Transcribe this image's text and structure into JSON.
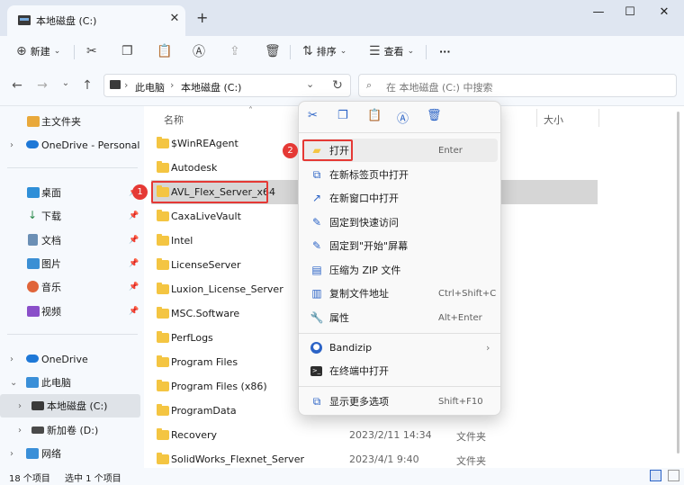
{
  "window": {
    "tab_title": "本地磁盘 (C:)",
    "tab_close": "✕",
    "tab_add": "+",
    "minimize": "—",
    "maximize": "☐",
    "close": "✕"
  },
  "toolbar": {
    "new_label": "新建",
    "sort_label": "排序",
    "view_label": "查看",
    "more": "···"
  },
  "address": {
    "crumb1": "此电脑",
    "crumb2": "本地磁盘 (C:)",
    "search_placeholder": "在 本地磁盘 (C:) 中搜索"
  },
  "sidebar": {
    "items": [
      {
        "label": "主文件夹"
      },
      {
        "label": "OneDrive - Personal"
      },
      {
        "label": "桌面"
      },
      {
        "label": "下载"
      },
      {
        "label": "文档"
      },
      {
        "label": "图片"
      },
      {
        "label": "音乐"
      },
      {
        "label": "视频"
      },
      {
        "label": "OneDrive"
      },
      {
        "label": "此电脑"
      },
      {
        "label": "本地磁盘 (C:)"
      },
      {
        "label": "新加卷 (D:)"
      },
      {
        "label": "网络"
      }
    ]
  },
  "columns": {
    "name": "名称",
    "size": "大小"
  },
  "files": [
    {
      "name": "$WinREAgent",
      "date": "",
      "type": ""
    },
    {
      "name": "Autodesk",
      "date": "",
      "type": ""
    },
    {
      "name": "AVL_Flex_Server_x64",
      "date": "",
      "type": ""
    },
    {
      "name": "CaxaLiveVault",
      "date": "",
      "type": ""
    },
    {
      "name": "Intel",
      "date": "",
      "type": ""
    },
    {
      "name": "LicenseServer",
      "date": "",
      "type": ""
    },
    {
      "name": "Luxion_License_Server",
      "date": "",
      "type": ""
    },
    {
      "name": "MSC.Software",
      "date": "",
      "type": ""
    },
    {
      "name": "PerfLogs",
      "date": "",
      "type": ""
    },
    {
      "name": "Program Files",
      "date": "",
      "type": ""
    },
    {
      "name": "Program Files (x86)",
      "date": "",
      "type": ""
    },
    {
      "name": "ProgramData",
      "date": "",
      "type": ""
    },
    {
      "name": "Recovery",
      "date": "2023/2/11 14:34",
      "type": "文件夹"
    },
    {
      "name": "SolidWorks_Flexnet_Server",
      "date": "2023/4/1 9:40",
      "type": "文件夹"
    }
  ],
  "context_menu": {
    "items": [
      {
        "label": "打开",
        "shortcut": "Enter"
      },
      {
        "label": "在新标签页中打开",
        "shortcut": ""
      },
      {
        "label": "在新窗口中打开",
        "shortcut": ""
      },
      {
        "label": "固定到快速访问",
        "shortcut": ""
      },
      {
        "label": "固定到\"开始\"屏幕",
        "shortcut": ""
      },
      {
        "label": "压缩为 ZIP 文件",
        "shortcut": ""
      },
      {
        "label": "复制文件地址",
        "shortcut": "Ctrl+Shift+C"
      },
      {
        "label": "属性",
        "shortcut": "Alt+Enter"
      },
      {
        "label": "Bandizip",
        "shortcut": ""
      },
      {
        "label": "在终端中打开",
        "shortcut": ""
      },
      {
        "label": "显示更多选项",
        "shortcut": "Shift+F10"
      }
    ]
  },
  "annotations": {
    "badge1": "1",
    "badge2": "2"
  },
  "status": {
    "count": "18 个项目",
    "selected": "选中 1 个项目"
  },
  "colors": {
    "accent": "#2b63c6",
    "highlight_red": "#e53935",
    "folder": "#f4c542"
  }
}
